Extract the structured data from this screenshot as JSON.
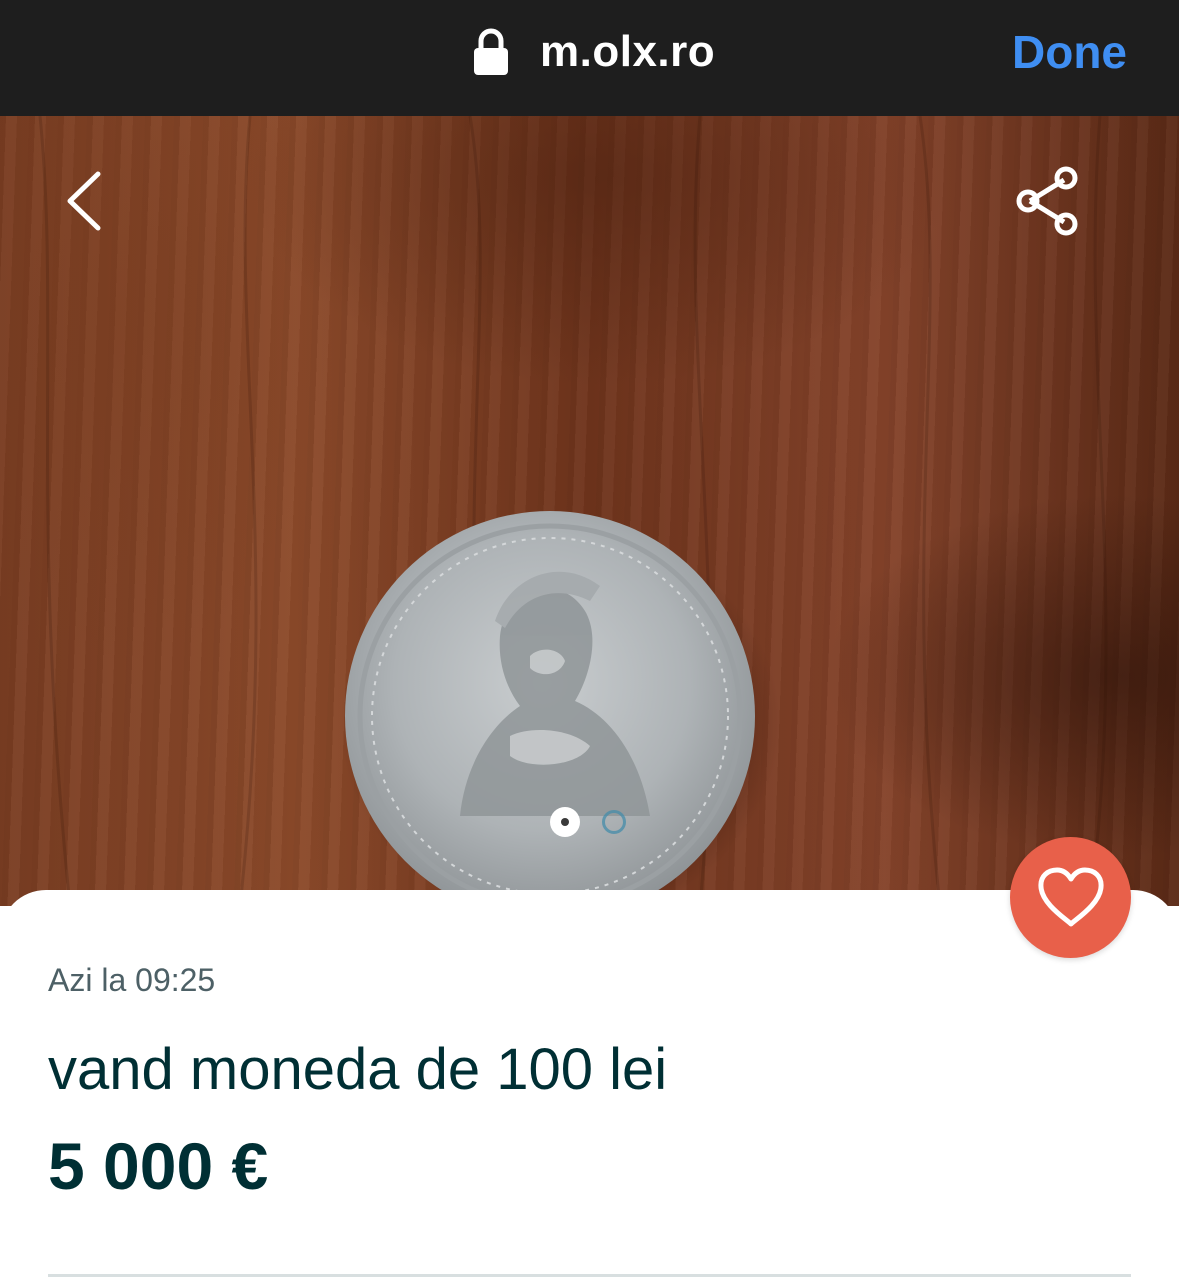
{
  "browser": {
    "url": "m.olx.ro",
    "done_label": "Done",
    "lock_icon": "lock-icon"
  },
  "gallery": {
    "back_icon": "chevron-left-icon",
    "share_icon": "share-icon",
    "image_count": 2,
    "active_index": 1,
    "image_description_icon": "coin-photo"
  },
  "listing": {
    "posted": "Azi la 09:25",
    "title": "vand moneda de 100 lei",
    "price": "5 000 €",
    "favorite_icon": "heart-icon"
  },
  "colors": {
    "topbar_bg": "#1e1e1e",
    "done_blue": "#3f8ef2",
    "favorite_bg": "#e8604a",
    "text_dark": "#002f34",
    "text_muted": "#4d6066"
  }
}
